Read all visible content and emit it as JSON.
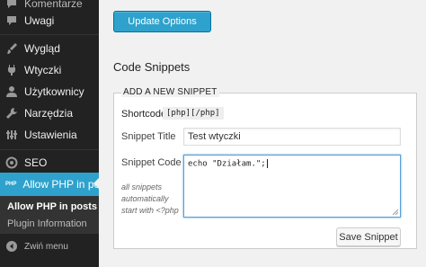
{
  "sidebar": {
    "partial_item_label": "Komentarze",
    "items": [
      {
        "label": "Uwagi",
        "icon": "comment-icon"
      },
      {
        "label": "Wygląd",
        "icon": "brush-icon"
      },
      {
        "label": "Wtyczki",
        "icon": "plugin-icon"
      },
      {
        "label": "Użytkownicy",
        "icon": "users-icon"
      },
      {
        "label": "Narzędzia",
        "icon": "wrench-icon"
      },
      {
        "label": "Ustawienia",
        "icon": "settings-icon"
      },
      {
        "label": "SEO",
        "icon": "seo-icon"
      }
    ],
    "active_item": {
      "label": "Allow PHP in posts",
      "badge": "PHP"
    },
    "submenu": [
      {
        "label": "Allow PHP in posts"
      },
      {
        "label": "Plugin Information"
      }
    ],
    "collapse_label": "Zwiń menu"
  },
  "content": {
    "update_button": "Update Options",
    "section_title": "Code Snippets",
    "fieldset_legend": "ADD A NEW SNIPPET",
    "shortcode_label": "Shortcode:",
    "shortcode_value": "[php][/php]",
    "title_label": "Snippet Title",
    "title_value": "Test wtyczki",
    "code_label": "Snippet Code",
    "code_value": "echo \"Działam.\";",
    "hint": "all snippets automatically start with <?php",
    "save_button": "Save Snippet"
  },
  "colors": {
    "accent": "#2ea2cc",
    "sidebar_bg": "#222222",
    "page_bg": "#f1f1f1"
  }
}
